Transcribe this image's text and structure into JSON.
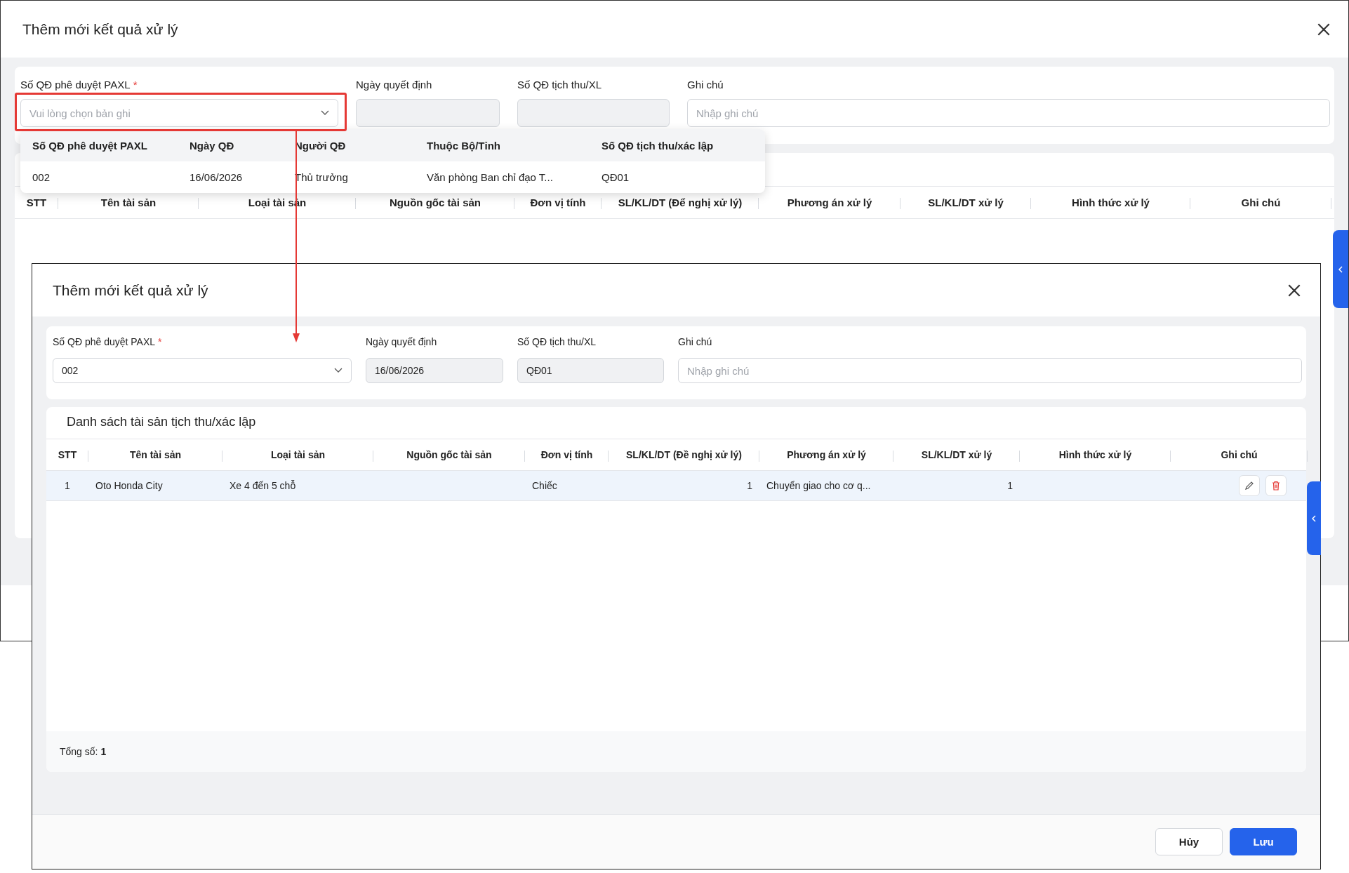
{
  "back_dialog": {
    "title": "Thêm mới kết quả xử lý",
    "fields": [
      {
        "label": "Số QĐ phê duyệt PAXL",
        "required_mark": "*",
        "kind": "select",
        "placeholder": "Vui lòng chọn bản ghi",
        "annotated": true
      },
      {
        "label": "Ngày quyết định",
        "kind": "input",
        "disabled": true
      },
      {
        "label": "Số QĐ tịch thu/XL",
        "kind": "input",
        "disabled": true
      },
      {
        "label": "Ghi chú",
        "kind": "input",
        "placeholder": "Nhập ghi chú",
        "disabled": false
      }
    ],
    "dropdown": {
      "columns": [
        "Số QĐ phê duyệt PAXL",
        "Ngày QĐ",
        "Người QĐ",
        "Thuộc Bộ/Tỉnh",
        "Số QĐ tịch thu/xác lập"
      ],
      "rows": [
        [
          "002",
          "16/06/2026",
          "Thủ trưởng",
          "Văn phòng Ban chỉ đạo T...",
          "QĐ01"
        ]
      ]
    },
    "table": {
      "columns": [
        "STT",
        "Tên tài sản",
        "Loại tài sản",
        "Nguồn gốc tài sản",
        "Đơn vị tính",
        "SL/KL/DT (Để nghị xử lý)",
        "Phương án xử lý",
        "SL/KL/DT xử lý",
        "Hình thức xử lý",
        "Ghi chú"
      ]
    }
  },
  "front_dialog": {
    "title": "Thêm mới kết quả xử lý",
    "fields": [
      {
        "label": "Số QĐ phê duyệt PAXL",
        "required_mark": "*",
        "kind": "select",
        "value": "002"
      },
      {
        "label": "Ngày quyết định",
        "kind": "input",
        "value": "16/06/2026",
        "disabled": true
      },
      {
        "label": "Số QĐ tịch thu/XL",
        "kind": "input",
        "value": "QĐ01",
        "disabled": true
      },
      {
        "label": "Ghi chú",
        "kind": "input",
        "placeholder": "Nhập ghi chú",
        "disabled": false
      }
    ],
    "table": {
      "title": "Danh sách tài sản tịch thu/xác lập",
      "columns": [
        "STT",
        "Tên tài sản",
        "Loại tài sản",
        "Nguồn gốc tài sản",
        "Đơn vị tính",
        "SL/KL/DT (Đề nghị xử lý)",
        "Phương án xử lý",
        "SL/KL/DT xử lý",
        "Hình thức xử lý",
        "Ghi chú"
      ],
      "rows": [
        {
          "selected": true,
          "cells": [
            "1",
            "Oto Honda City",
            "Xe 4 đến 5 chỗ",
            null,
            "Chiếc",
            "1",
            "Chuyển giao cho cơ q...",
            "1",
            null,
            null
          ]
        }
      ],
      "total": "Tổng số: **1**"
    },
    "buttons": [
      {
        "label": "Hủy",
        "kind": "secondary"
      },
      {
        "label": "Lưu",
        "kind": "primary"
      }
    ]
  }
}
